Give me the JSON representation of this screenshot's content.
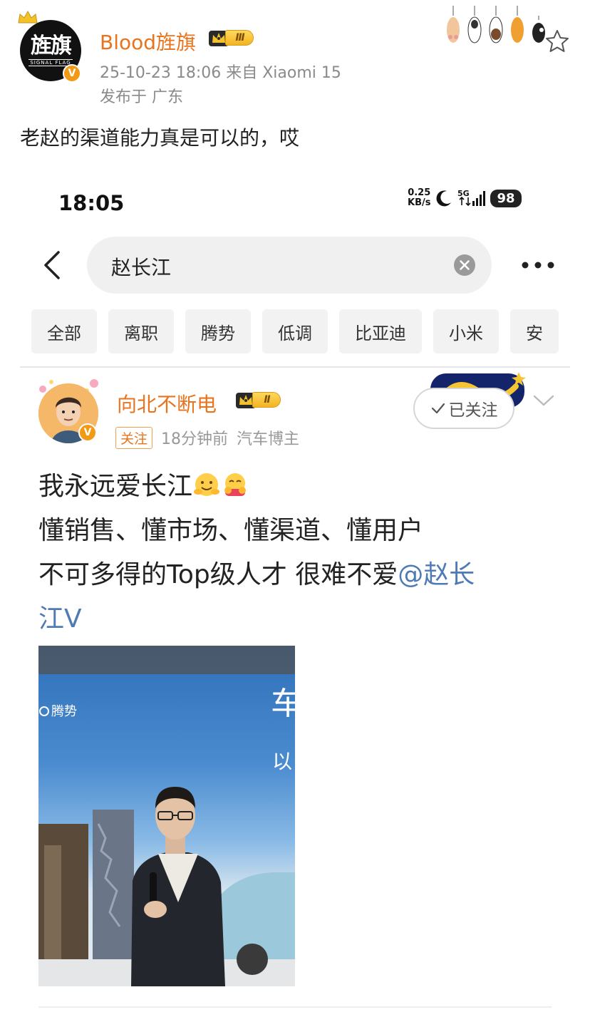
{
  "post": {
    "author": "Blood旌旗",
    "level": "Ⅲ",
    "avatar_logo_text": "旌旗",
    "avatar_logo_sub": "SIGNAL FLAG",
    "meta": "25-10-23 18:06  来自 Xiaomi 15",
    "location": "发布于 广东",
    "text": "老赵的渠道能力真是可以的，哎"
  },
  "embedded": {
    "status": {
      "time": "18:05",
      "net_speed_value": "0.25",
      "net_speed_unit": "KB/s",
      "network": "5G",
      "battery": "98"
    },
    "search": {
      "query": "赵长江"
    },
    "chips": [
      "全部",
      "离职",
      "腾势",
      "低调",
      "比亚迪",
      "小米",
      "安"
    ],
    "inner_post": {
      "author": "向北不断电",
      "level": "Ⅱ",
      "follow_button": "已关注",
      "follow_tag": "关注",
      "time": "18分钟前",
      "role": "汽车博主",
      "line1": "我永远爱长江",
      "line2": "懂销售、懂市场、懂渠道、懂用户",
      "line3_prefix": "不可多得的Top级人才 很难不爱",
      "mention_part1": "@赵长",
      "mention_part2": "江V",
      "photo_brand_text": "腾势",
      "photo_sign_char1": "车",
      "photo_sign_char2": "以"
    }
  },
  "colors": {
    "brand_orange": "#e9741d",
    "mention_blue": "#4e7ab5",
    "meta_gray": "#8a8a8a"
  },
  "icons": [
    "crown-icon",
    "verified-icon",
    "paw-icon",
    "star-icon",
    "moon-icon",
    "signal-icon",
    "back-icon",
    "clear-icon",
    "more-icon",
    "check-icon",
    "chevron-down-icon",
    "hug-emoji-icon"
  ]
}
